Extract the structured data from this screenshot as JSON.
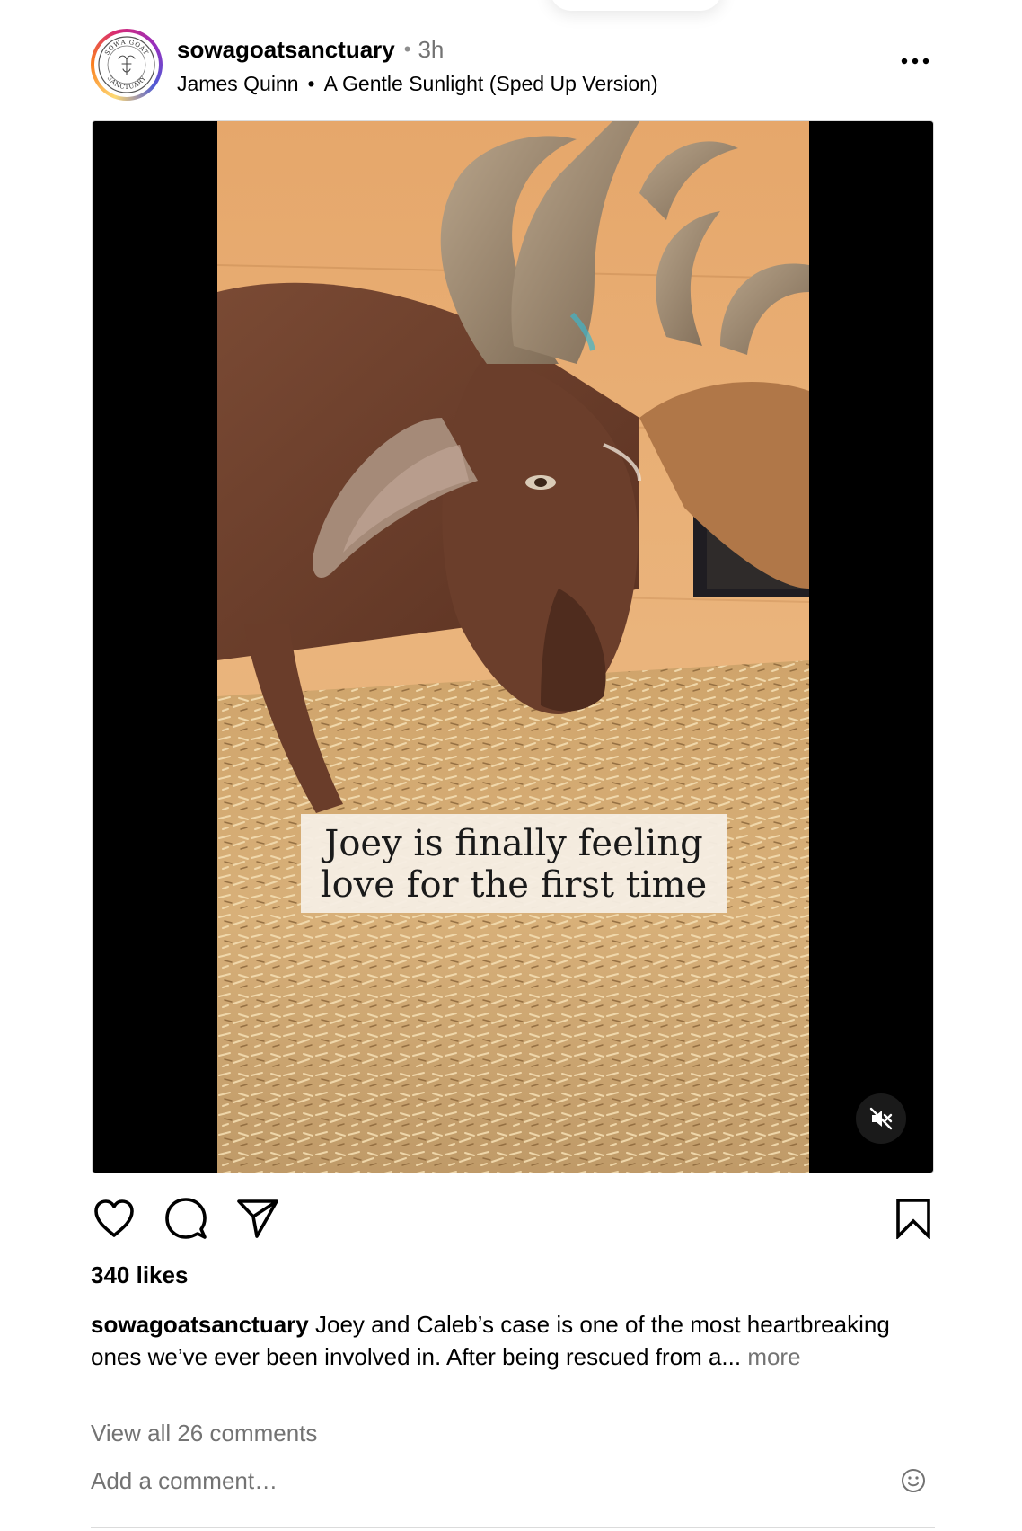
{
  "post": {
    "username": "sowagoatsanctuary",
    "separator": "•",
    "time": "3h",
    "avatar_logo_top": "SOWA GOAT",
    "avatar_logo_bottom": "SANCTUARY",
    "music": {
      "artist": "James Quinn",
      "separator": "•",
      "track": "A Gentle Sunlight (Sped Up Version)"
    }
  },
  "media": {
    "overlay_line1": "Joey is finally feeling",
    "overlay_line2": "love for the first time",
    "muted": true
  },
  "actions": {
    "like_icon": "heart-icon",
    "comment_icon": "comment-icon",
    "share_icon": "send-icon",
    "save_icon": "bookmark-icon"
  },
  "likes": "340 likes",
  "caption": {
    "username": "sowagoatsanctuary",
    "text": "Joey and Caleb’s case is one of the most heartbreaking ones we’ve ever been involved in. After being rescued from a...",
    "more": "more"
  },
  "comments": {
    "view_all": "View all 26 comments",
    "placeholder": "Add a comment…"
  },
  "colors": {
    "secondary_text": "#737373",
    "border": "#dbdbdb",
    "ring_gradient": [
      "#feda75",
      "#fa7e1e",
      "#d62976",
      "#962fbf",
      "#4f5bd5"
    ]
  }
}
